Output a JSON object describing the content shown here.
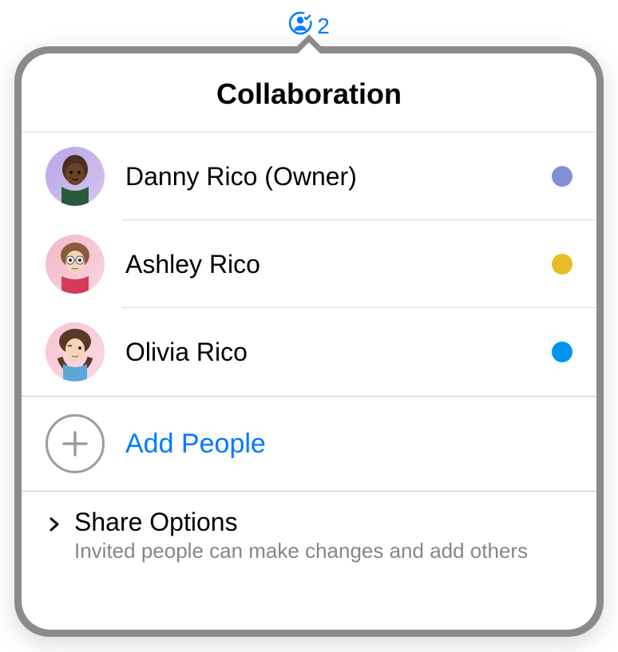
{
  "badge": {
    "count": "2"
  },
  "popover": {
    "title": "Collaboration"
  },
  "people": [
    {
      "name": "Danny Rico (Owner)",
      "dot_color": "#8190d6"
    },
    {
      "name": "Ashley Rico",
      "dot_color": "#e9bc26"
    },
    {
      "name": "Olivia Rico",
      "dot_color": "#0095f2"
    }
  ],
  "add_people": {
    "label": "Add People"
  },
  "share_options": {
    "title": "Share Options",
    "subtitle": "Invited people can make changes and add others"
  }
}
